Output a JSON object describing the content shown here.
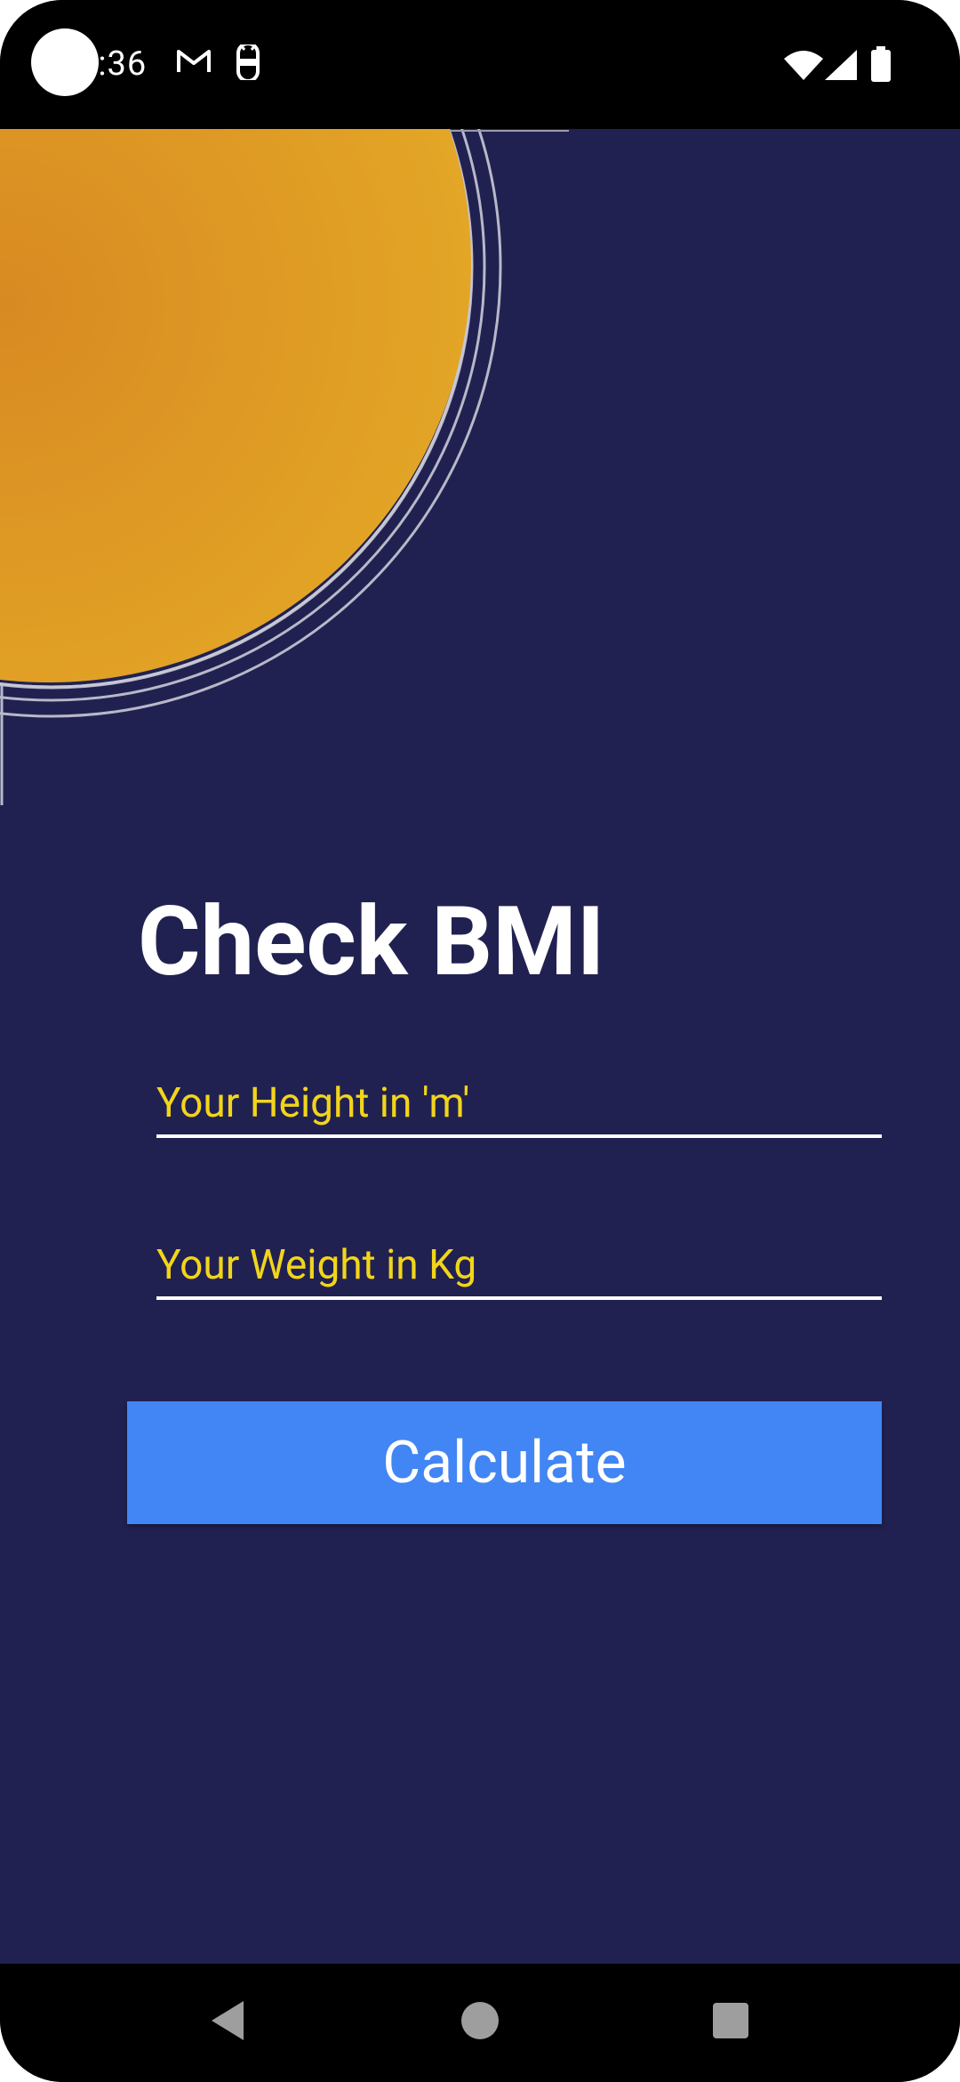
{
  "status_bar": {
    "time": "0:36",
    "icons": [
      "gmail-icon",
      "android-icon",
      "wifi-icon",
      "signal-icon",
      "battery-icon"
    ]
  },
  "main": {
    "title": "Check BMI",
    "height_field": {
      "value": "",
      "placeholder": "Your Height in 'm'"
    },
    "weight_field": {
      "value": "",
      "placeholder": "Your Weight in Kg"
    },
    "calculate_label": "Calculate"
  },
  "nav_bar": {
    "icons": [
      "back-icon",
      "home-icon",
      "recents-icon"
    ]
  },
  "colors": {
    "background": "#212151",
    "accent_yellow": "#fddc1f",
    "button": "#4285f4",
    "sun_outer": "#e4a826",
    "sun_inner": "#d88a22"
  }
}
